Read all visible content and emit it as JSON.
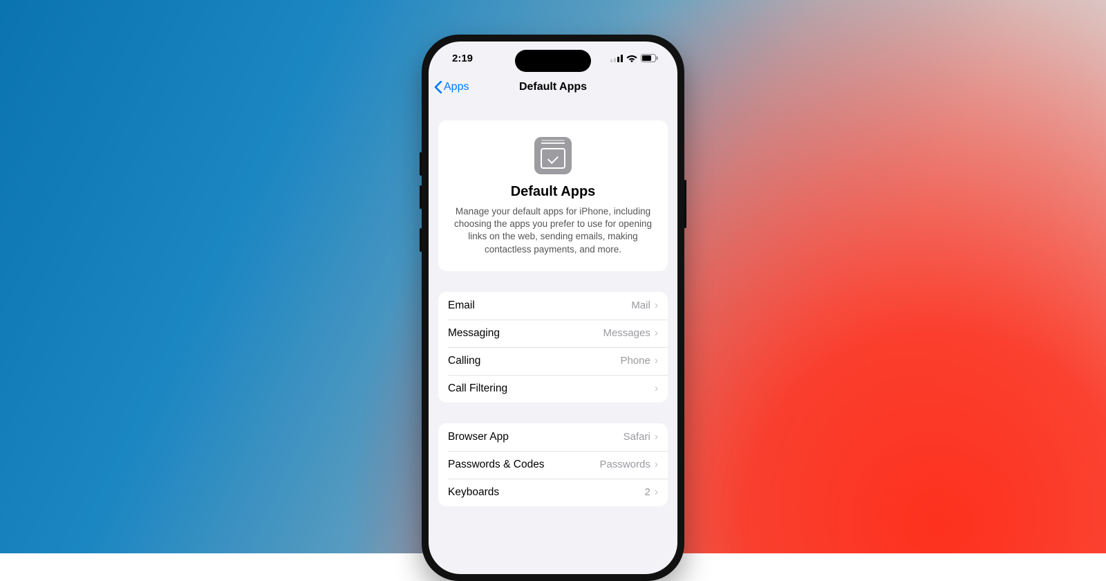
{
  "status": {
    "time": "2:19"
  },
  "nav": {
    "back": "Apps",
    "title": "Default Apps"
  },
  "hero": {
    "title": "Default Apps",
    "body": "Manage your default apps for iPhone, including choosing the apps you prefer to use for opening links on the web, sending emails, making contactless payments, and more."
  },
  "group1": [
    {
      "label": "Email",
      "value": "Mail"
    },
    {
      "label": "Messaging",
      "value": "Messages"
    },
    {
      "label": "Calling",
      "value": "Phone"
    },
    {
      "label": "Call Filtering",
      "value": ""
    }
  ],
  "group2": [
    {
      "label": "Browser App",
      "value": "Safari"
    },
    {
      "label": "Passwords & Codes",
      "value": "Passwords"
    },
    {
      "label": "Keyboards",
      "value": "2"
    }
  ]
}
